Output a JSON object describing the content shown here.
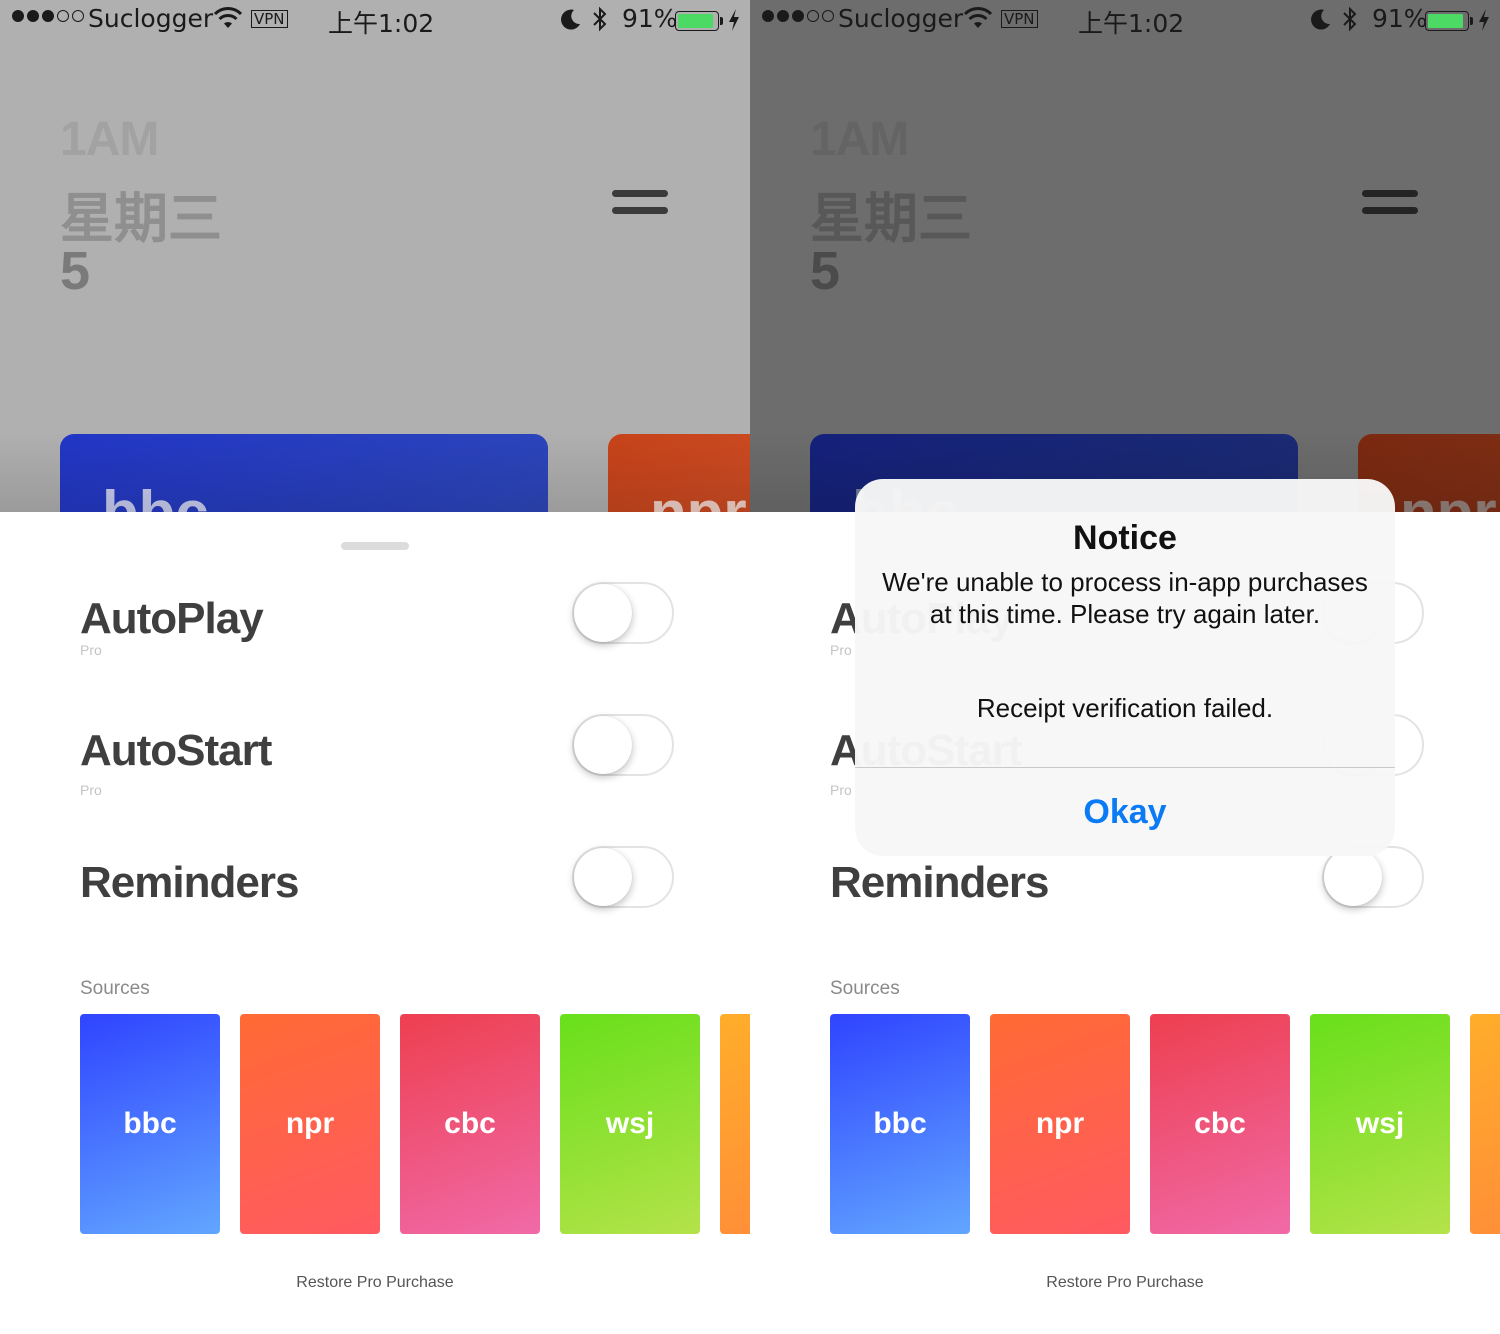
{
  "status_bar": {
    "carrier": "Suclogger",
    "vpn": "VPN",
    "time": "上午1:02",
    "battery_pct": "91%",
    "battery_level": 0.91,
    "battery_color": "#4cd964"
  },
  "header": {
    "hour": "1AM",
    "weekday": "星期三",
    "date": "5",
    "menu_icon": "hamburger-icon"
  },
  "hero_cards": [
    {
      "label": "bbc",
      "color": "#2236c7"
    },
    {
      "label": "npr",
      "color": "#c8431a"
    }
  ],
  "settings": [
    {
      "title": "AutoPlay",
      "subtitle": "Pro",
      "enabled": false
    },
    {
      "title": "AutoStart",
      "subtitle": "Pro",
      "enabled": false
    },
    {
      "title": "Reminders",
      "subtitle": "",
      "enabled": false
    }
  ],
  "sources": {
    "label": "Sources",
    "tiles": [
      {
        "label": "bbc",
        "from": "#2f44ff",
        "to": "#62a6ff"
      },
      {
        "label": "npr",
        "from": "#ff6a34",
        "to": "#ff5a62"
      },
      {
        "label": "cbc",
        "from": "#ee3f4f",
        "to": "#f06aa8"
      },
      {
        "label": "wsj",
        "from": "#68e01a",
        "to": "#b4e24a"
      },
      {
        "label": "",
        "from": "#ffad2a",
        "to": "#ff8a3a"
      }
    ]
  },
  "restore_label": "Restore Pro Purchase",
  "alert": {
    "title": "Notice",
    "message": "We're unable to process in-app purchases at this time. Please try again later.",
    "note": "Receipt verification failed.",
    "button": "Okay",
    "button_color": "#0a7af5"
  }
}
